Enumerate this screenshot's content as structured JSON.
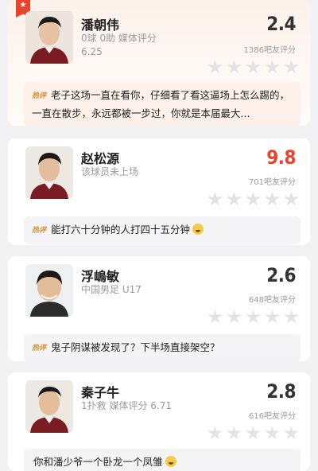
{
  "players": [
    {
      "name": "潘朝伟",
      "sub_line1": "0球 0助  媒体评分",
      "sub_line2": "6.25",
      "score": "2.4",
      "rating_count": "1386吧友评分",
      "score_color": "#333333",
      "comment_tag": "热评",
      "comment": "老子这场一直在看你，仔细看了看这逼场上怎么踢的，一直在散步，永远都被一步过，你就是本届最大...",
      "has_flag": true
    },
    {
      "name": "赵松源",
      "sub_line1": "该球员未上场",
      "sub_line2": "",
      "score": "9.8",
      "rating_count": "701吧友评分",
      "score_color": "#e8442d",
      "comment_tag": "热评",
      "comment": "能打六十分钟的人打四十五分钟",
      "emoji": "crying-laugh-emoji"
    },
    {
      "name": "浮嶋敏",
      "sub_line1": "中国男足 U17",
      "sub_line2": "",
      "score": "2.6",
      "rating_count": "648吧友评分",
      "score_color": "#333333",
      "comment_tag": "热评",
      "comment": "鬼子阴谋被发现了？下半场直接架空？"
    },
    {
      "name": "秦子牛",
      "sub_line1": "1扑救  媒体评分 6.71",
      "sub_line2": "",
      "score": "2.8",
      "rating_count": "616吧友评分",
      "score_color": "#333333",
      "comment_tag": "",
      "comment": "你和潘少爷一个卧龙一个凤雏",
      "emoji": "crying-laugh-emoji"
    }
  ]
}
